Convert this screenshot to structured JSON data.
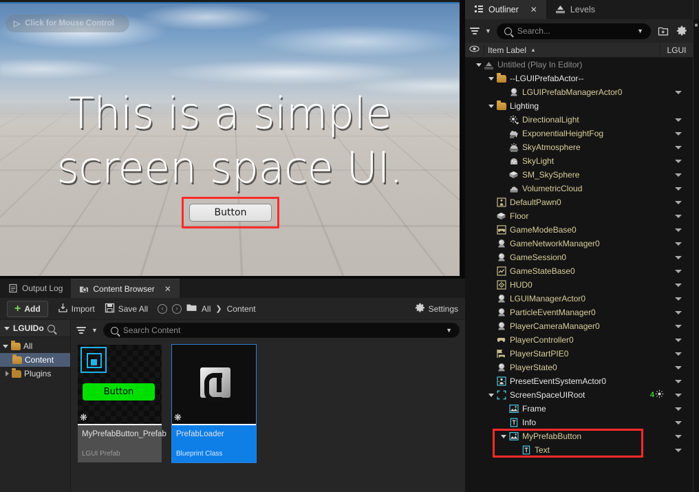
{
  "viewport": {
    "mouse_hint": "Click for Mouse Control",
    "cursor_icon": "cursor-arrow-icon",
    "overlay_text_line1": "This is a simple",
    "overlay_text_line2": "screen space UI.",
    "button_label": "Button",
    "highlight_color": "#ff2a2a"
  },
  "content_browser": {
    "tabs": [
      {
        "label": "Output Log",
        "icon": "output-log-icon",
        "active": false,
        "closable": false
      },
      {
        "label": "Content Browser",
        "icon": "content-browser-icon",
        "active": true,
        "closable": true,
        "close_label": "✕"
      }
    ],
    "toolbar": {
      "add_label": "Add",
      "add_glyph": "+",
      "import_label": "Import",
      "save_all_label": "Save All",
      "back_glyph": "‹",
      "forward_glyph": "›",
      "settings_label": "Settings"
    },
    "breadcrumb": {
      "root": "All",
      "separator": "❯",
      "current": "Content"
    },
    "sources": {
      "header": "LGUIDo",
      "items": [
        {
          "label": "All",
          "indent": 0,
          "selected": false,
          "expanded": true,
          "folder": "open"
        },
        {
          "label": "Content",
          "indent": 1,
          "selected": true,
          "expanded": false,
          "folder": "open"
        },
        {
          "label": "Plugins",
          "indent": 1,
          "selected": false,
          "expanded": false,
          "folder": "closed",
          "collapsed_arrow": true
        }
      ]
    },
    "search": {
      "placeholder": "Search Content"
    },
    "assets": [
      {
        "name": "MyPrefabButton_Prefab",
        "type": "LGUI Prefab",
        "selected": false,
        "thumb_kind": "lgui-prefab",
        "thumb_button_label": "Button",
        "thumb_button_color": "#00e000"
      },
      {
        "name": "PrefabLoader",
        "type": "Blueprint Class",
        "selected": true,
        "thumb_kind": "blueprint",
        "selected_color": "#0f7fe8"
      }
    ]
  },
  "outliner": {
    "tabs": [
      {
        "label": "Outliner",
        "icon": "outliner-icon",
        "active": true,
        "closable": true,
        "close_label": "✕"
      },
      {
        "label": "Levels",
        "icon": "levels-icon",
        "active": false,
        "closable": false
      }
    ],
    "toolbar": {
      "filter_icon": "filter-icon",
      "filter_chevron": "⌄",
      "search_placeholder": "Search...",
      "search_chevron": "⌄",
      "new_folder_icon": "new-folder-icon",
      "settings_icon": "gear-icon"
    },
    "columns": {
      "eye": "◉",
      "item_label": "Item Label",
      "sort_glyph": "▲",
      "lgui": "LGUI"
    },
    "rows": [
      {
        "label": "Untitled (Play In Editor)",
        "indent": 0,
        "icon": "level-icon",
        "style": "dim",
        "expander": "down",
        "arrow": false
      },
      {
        "label": "--LGUIPrefabActor--",
        "indent": 1,
        "icon": "folder-icon",
        "style": "white",
        "expander": "down",
        "arrow": false
      },
      {
        "label": "LGUIPrefabManagerActor0",
        "indent": 2,
        "icon": "actor-sphere-icon",
        "style": "actor",
        "expander": "none",
        "arrow": true
      },
      {
        "label": "Lighting",
        "indent": 1,
        "icon": "folder-icon",
        "style": "white",
        "expander": "down",
        "arrow": false
      },
      {
        "label": "DirectionalLight",
        "indent": 2,
        "icon": "directional-light-icon",
        "style": "actor",
        "expander": "none",
        "arrow": true
      },
      {
        "label": "ExponentialHeightFog",
        "indent": 2,
        "icon": "fog-icon",
        "style": "actor",
        "expander": "none",
        "arrow": true
      },
      {
        "label": "SkyAtmosphere",
        "indent": 2,
        "icon": "sky-atmosphere-icon",
        "style": "actor",
        "expander": "none",
        "arrow": true
      },
      {
        "label": "SkyLight",
        "indent": 2,
        "icon": "sky-light-icon",
        "style": "actor",
        "expander": "none",
        "arrow": true
      },
      {
        "label": "SM_SkySphere",
        "indent": 2,
        "icon": "static-mesh-icon",
        "style": "actor",
        "expander": "none",
        "arrow": true
      },
      {
        "label": "VolumetricCloud",
        "indent": 2,
        "icon": "volumetric-cloud-icon",
        "style": "actor",
        "expander": "none",
        "arrow": true
      },
      {
        "label": "DefaultPawn0",
        "indent": 1,
        "icon": "pawn-icon",
        "style": "actor",
        "expander": "none",
        "arrow": true
      },
      {
        "label": "Floor",
        "indent": 1,
        "icon": "static-mesh-icon",
        "style": "actor",
        "expander": "none",
        "arrow": true
      },
      {
        "label": "GameModeBase0",
        "indent": 1,
        "icon": "gamemode-icon",
        "style": "actor",
        "expander": "none",
        "arrow": true
      },
      {
        "label": "GameNetworkManager0",
        "indent": 1,
        "icon": "actor-sphere-icon",
        "style": "actor",
        "expander": "none",
        "arrow": true
      },
      {
        "label": "GameSession0",
        "indent": 1,
        "icon": "actor-sphere-icon",
        "style": "actor",
        "expander": "none",
        "arrow": true
      },
      {
        "label": "GameStateBase0",
        "indent": 1,
        "icon": "gamestate-icon",
        "style": "actor",
        "expander": "none",
        "arrow": true
      },
      {
        "label": "HUD0",
        "indent": 1,
        "icon": "hud-icon",
        "style": "actor",
        "expander": "none",
        "arrow": true
      },
      {
        "label": "LGUIManagerActor0",
        "indent": 1,
        "icon": "actor-sphere-icon",
        "style": "actor",
        "expander": "none",
        "arrow": true
      },
      {
        "label": "ParticleEventManager0",
        "indent": 1,
        "icon": "actor-sphere-icon",
        "style": "actor",
        "expander": "none",
        "arrow": true
      },
      {
        "label": "PlayerCameraManager0",
        "indent": 1,
        "icon": "actor-sphere-icon",
        "style": "actor",
        "expander": "none",
        "arrow": true
      },
      {
        "label": "PlayerController0",
        "indent": 1,
        "icon": "controller-icon",
        "style": "actor",
        "expander": "none",
        "arrow": true
      },
      {
        "label": "PlayerStartPIE0",
        "indent": 1,
        "icon": "player-start-icon",
        "style": "actor",
        "expander": "none",
        "arrow": true
      },
      {
        "label": "PlayerState0",
        "indent": 1,
        "icon": "actor-sphere-icon",
        "style": "actor",
        "expander": "none",
        "arrow": true
      },
      {
        "label": "PresetEventSystemActor0",
        "indent": 1,
        "icon": "event-system-icon",
        "style": "white",
        "expander": "none",
        "arrow": true
      },
      {
        "label": "ScreenSpaceUIRoot",
        "indent": 1,
        "icon": "ui-root-icon",
        "style": "white",
        "expander": "down",
        "arrow": true,
        "badge": "4",
        "badge_icon": "sun-icon",
        "badge_color": "#37d237"
      },
      {
        "label": "Frame",
        "indent": 2,
        "icon": "ui-sprite-icon",
        "style": "white",
        "expander": "none",
        "arrow": true
      },
      {
        "label": "Info",
        "indent": 2,
        "icon": "ui-text-icon",
        "style": "white",
        "expander": "none",
        "arrow": true
      },
      {
        "label": "MyPrefabButton",
        "indent": 2,
        "icon": "ui-sprite-icon",
        "style": "actor",
        "expander": "down",
        "arrow": true,
        "highlighted": true
      },
      {
        "label": "Text",
        "indent": 3,
        "icon": "ui-text-icon",
        "style": "actor",
        "expander": "none",
        "arrow": true,
        "highlighted": true
      }
    ],
    "highlight_color": "#ff2a2a"
  }
}
